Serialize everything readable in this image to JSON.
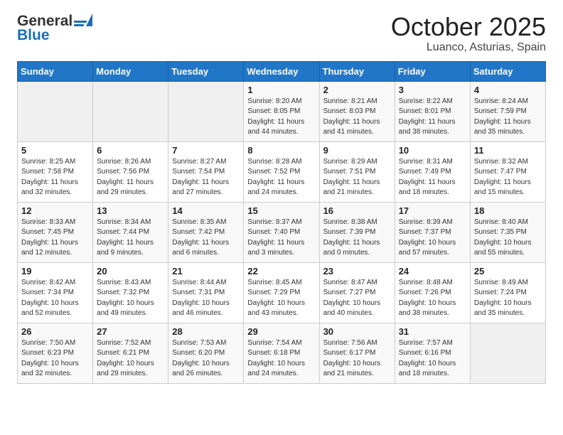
{
  "header": {
    "logo_general": "General",
    "logo_blue": "Blue",
    "month_title": "October 2025",
    "location": "Luanco, Asturias, Spain"
  },
  "weekdays": [
    "Sunday",
    "Monday",
    "Tuesday",
    "Wednesday",
    "Thursday",
    "Friday",
    "Saturday"
  ],
  "weeks": [
    [
      {
        "day": "",
        "info": ""
      },
      {
        "day": "",
        "info": ""
      },
      {
        "day": "",
        "info": ""
      },
      {
        "day": "1",
        "info": "Sunrise: 8:20 AM\nSunset: 8:05 PM\nDaylight: 11 hours\nand 44 minutes."
      },
      {
        "day": "2",
        "info": "Sunrise: 8:21 AM\nSunset: 8:03 PM\nDaylight: 11 hours\nand 41 minutes."
      },
      {
        "day": "3",
        "info": "Sunrise: 8:22 AM\nSunset: 8:01 PM\nDaylight: 11 hours\nand 38 minutes."
      },
      {
        "day": "4",
        "info": "Sunrise: 8:24 AM\nSunset: 7:59 PM\nDaylight: 11 hours\nand 35 minutes."
      }
    ],
    [
      {
        "day": "5",
        "info": "Sunrise: 8:25 AM\nSunset: 7:58 PM\nDaylight: 11 hours\nand 32 minutes."
      },
      {
        "day": "6",
        "info": "Sunrise: 8:26 AM\nSunset: 7:56 PM\nDaylight: 11 hours\nand 29 minutes."
      },
      {
        "day": "7",
        "info": "Sunrise: 8:27 AM\nSunset: 7:54 PM\nDaylight: 11 hours\nand 27 minutes."
      },
      {
        "day": "8",
        "info": "Sunrise: 8:28 AM\nSunset: 7:52 PM\nDaylight: 11 hours\nand 24 minutes."
      },
      {
        "day": "9",
        "info": "Sunrise: 8:29 AM\nSunset: 7:51 PM\nDaylight: 11 hours\nand 21 minutes."
      },
      {
        "day": "10",
        "info": "Sunrise: 8:31 AM\nSunset: 7:49 PM\nDaylight: 11 hours\nand 18 minutes."
      },
      {
        "day": "11",
        "info": "Sunrise: 8:32 AM\nSunset: 7:47 PM\nDaylight: 11 hours\nand 15 minutes."
      }
    ],
    [
      {
        "day": "12",
        "info": "Sunrise: 8:33 AM\nSunset: 7:45 PM\nDaylight: 11 hours\nand 12 minutes."
      },
      {
        "day": "13",
        "info": "Sunrise: 8:34 AM\nSunset: 7:44 PM\nDaylight: 11 hours\nand 9 minutes."
      },
      {
        "day": "14",
        "info": "Sunrise: 8:35 AM\nSunset: 7:42 PM\nDaylight: 11 hours\nand 6 minutes."
      },
      {
        "day": "15",
        "info": "Sunrise: 8:37 AM\nSunset: 7:40 PM\nDaylight: 11 hours\nand 3 minutes."
      },
      {
        "day": "16",
        "info": "Sunrise: 8:38 AM\nSunset: 7:39 PM\nDaylight: 11 hours\nand 0 minutes."
      },
      {
        "day": "17",
        "info": "Sunrise: 8:39 AM\nSunset: 7:37 PM\nDaylight: 10 hours\nand 57 minutes."
      },
      {
        "day": "18",
        "info": "Sunrise: 8:40 AM\nSunset: 7:35 PM\nDaylight: 10 hours\nand 55 minutes."
      }
    ],
    [
      {
        "day": "19",
        "info": "Sunrise: 8:42 AM\nSunset: 7:34 PM\nDaylight: 10 hours\nand 52 minutes."
      },
      {
        "day": "20",
        "info": "Sunrise: 8:43 AM\nSunset: 7:32 PM\nDaylight: 10 hours\nand 49 minutes."
      },
      {
        "day": "21",
        "info": "Sunrise: 8:44 AM\nSunset: 7:31 PM\nDaylight: 10 hours\nand 46 minutes."
      },
      {
        "day": "22",
        "info": "Sunrise: 8:45 AM\nSunset: 7:29 PM\nDaylight: 10 hours\nand 43 minutes."
      },
      {
        "day": "23",
        "info": "Sunrise: 8:47 AM\nSunset: 7:27 PM\nDaylight: 10 hours\nand 40 minutes."
      },
      {
        "day": "24",
        "info": "Sunrise: 8:48 AM\nSunset: 7:26 PM\nDaylight: 10 hours\nand 38 minutes."
      },
      {
        "day": "25",
        "info": "Sunrise: 8:49 AM\nSunset: 7:24 PM\nDaylight: 10 hours\nand 35 minutes."
      }
    ],
    [
      {
        "day": "26",
        "info": "Sunrise: 7:50 AM\nSunset: 6:23 PM\nDaylight: 10 hours\nand 32 minutes."
      },
      {
        "day": "27",
        "info": "Sunrise: 7:52 AM\nSunset: 6:21 PM\nDaylight: 10 hours\nand 29 minutes."
      },
      {
        "day": "28",
        "info": "Sunrise: 7:53 AM\nSunset: 6:20 PM\nDaylight: 10 hours\nand 26 minutes."
      },
      {
        "day": "29",
        "info": "Sunrise: 7:54 AM\nSunset: 6:18 PM\nDaylight: 10 hours\nand 24 minutes."
      },
      {
        "day": "30",
        "info": "Sunrise: 7:56 AM\nSunset: 6:17 PM\nDaylight: 10 hours\nand 21 minutes."
      },
      {
        "day": "31",
        "info": "Sunrise: 7:57 AM\nSunset: 6:16 PM\nDaylight: 10 hours\nand 18 minutes."
      },
      {
        "day": "",
        "info": ""
      }
    ]
  ]
}
